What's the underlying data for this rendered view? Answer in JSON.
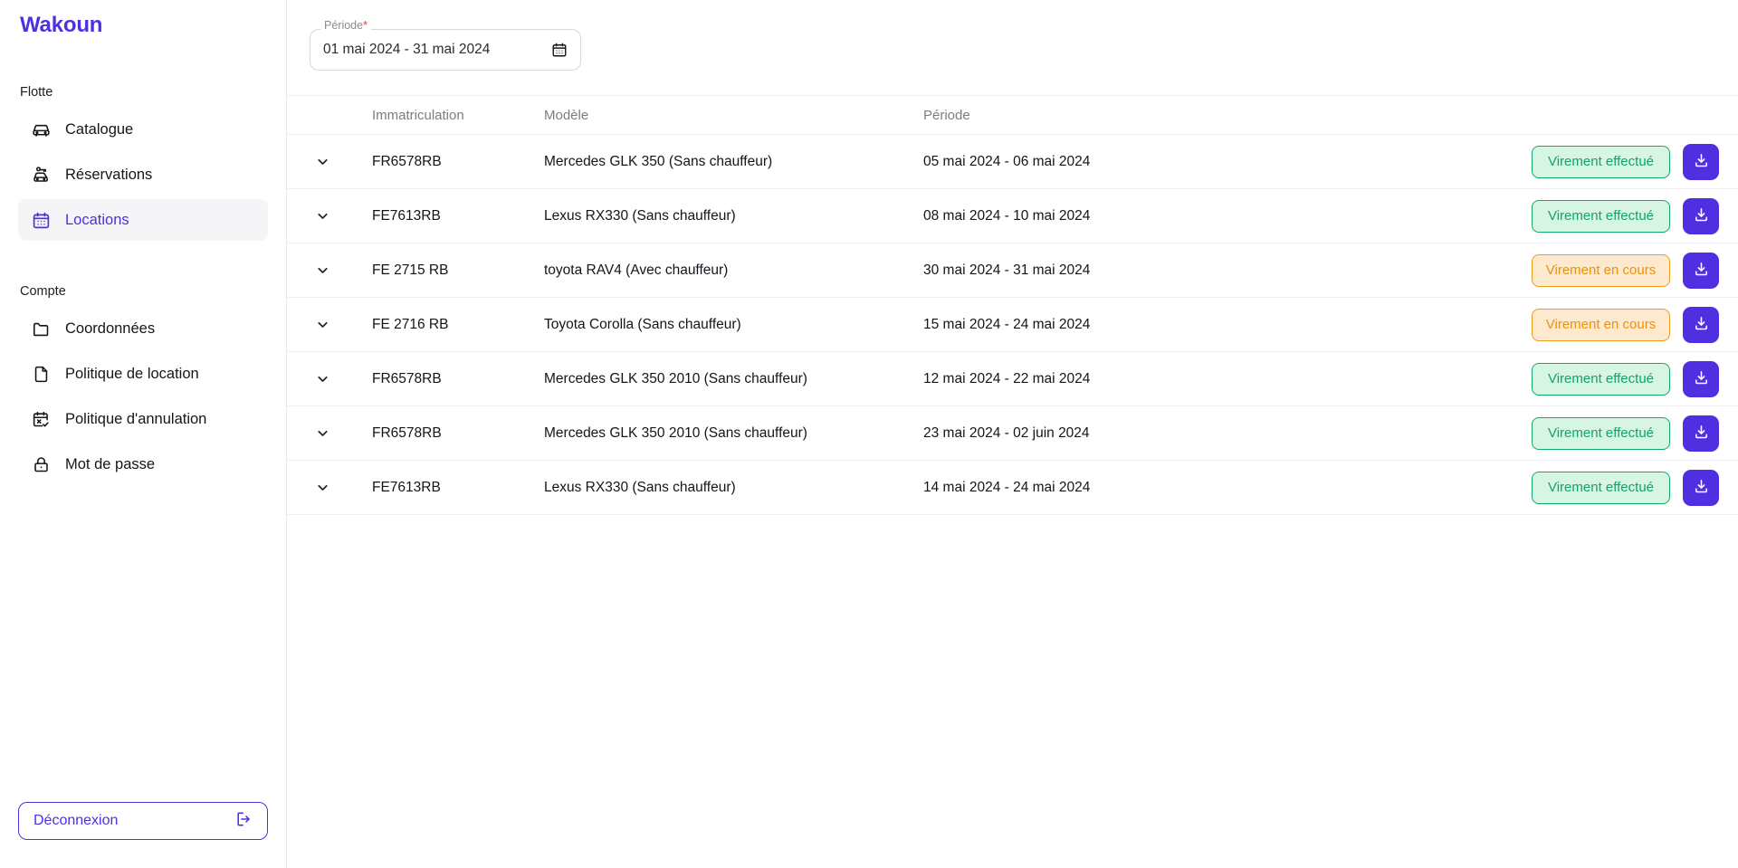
{
  "brand": {
    "name": "Wakoun",
    "color": "#4f2fe0"
  },
  "sidebar": {
    "sections": [
      {
        "label": "Flotte",
        "items": [
          {
            "label": "Catalogue",
            "icon": "car-icon",
            "active": false
          },
          {
            "label": "Réservations",
            "icon": "car-key-icon",
            "active": false
          },
          {
            "label": "Locations",
            "icon": "calendar-icon",
            "active": true
          }
        ]
      },
      {
        "label": "Compte",
        "items": [
          {
            "label": "Coordonnées",
            "icon": "folder-icon",
            "active": false
          },
          {
            "label": "Politique de location",
            "icon": "file-icon",
            "active": false
          },
          {
            "label": "Politique d'annulation",
            "icon": "calendar-x-icon",
            "active": false
          },
          {
            "label": "Mot de passe",
            "icon": "lock-icon",
            "active": false
          }
        ]
      }
    ],
    "logout": {
      "label": "Déconnexion",
      "icon": "logout-icon"
    }
  },
  "toolbar": {
    "period_field": {
      "label": "Période",
      "required_mark": "*",
      "value": "01 mai 2024 - 31 mai 2024",
      "icon": "calendar-icon"
    }
  },
  "table": {
    "headers": {
      "chevron": "",
      "immatriculation": "Immatriculation",
      "modele": "Modèle",
      "periode": "Période",
      "status": ""
    },
    "download_icon": "download-icon",
    "expand_icon": "chevron-down-icon",
    "rows": [
      {
        "immatriculation": "FR6578RB",
        "modele": "Mercedes GLK  350 (Sans chauffeur)",
        "periode": "05 mai 2024 - 06 mai 2024",
        "status": "Virement effectué",
        "status_type": "done"
      },
      {
        "immatriculation": "FE7613RB",
        "modele": "Lexus RX330 (Sans chauffeur)",
        "periode": "08 mai 2024 - 10 mai 2024",
        "status": "Virement effectué",
        "status_type": "done"
      },
      {
        "immatriculation": "FE 2715 RB",
        "modele": "toyota RAV4 (Avec chauffeur)",
        "periode": "30 mai 2024 - 31 mai 2024",
        "status": "Virement en cours",
        "status_type": "pending"
      },
      {
        "immatriculation": "FE 2716 RB",
        "modele": "Toyota Corolla (Sans chauffeur)",
        "periode": "15 mai 2024 - 24 mai 2024",
        "status": "Virement en cours",
        "status_type": "pending"
      },
      {
        "immatriculation": "FR6578RB",
        "modele": "Mercedes GLK  350 2010 (Sans chauffeur)",
        "periode": "12 mai 2024 - 22 mai 2024",
        "status": "Virement effectué",
        "status_type": "done"
      },
      {
        "immatriculation": "FR6578RB",
        "modele": "Mercedes GLK  350 2010 (Sans chauffeur)",
        "periode": "23 mai 2024 - 02 juin 2024",
        "status": "Virement effectué",
        "status_type": "done"
      },
      {
        "immatriculation": "FE7613RB",
        "modele": "Lexus RX330 (Sans chauffeur)",
        "periode": "14 mai 2024 - 24 mai 2024",
        "status": "Virement effectué",
        "status_type": "done"
      }
    ]
  },
  "colors": {
    "accent": "#4f2fe0",
    "status_done_text": "#14a365",
    "status_done_bg": "#d6f5e3",
    "status_pending_text": "#e8930f",
    "status_pending_bg": "#fde9cd"
  }
}
